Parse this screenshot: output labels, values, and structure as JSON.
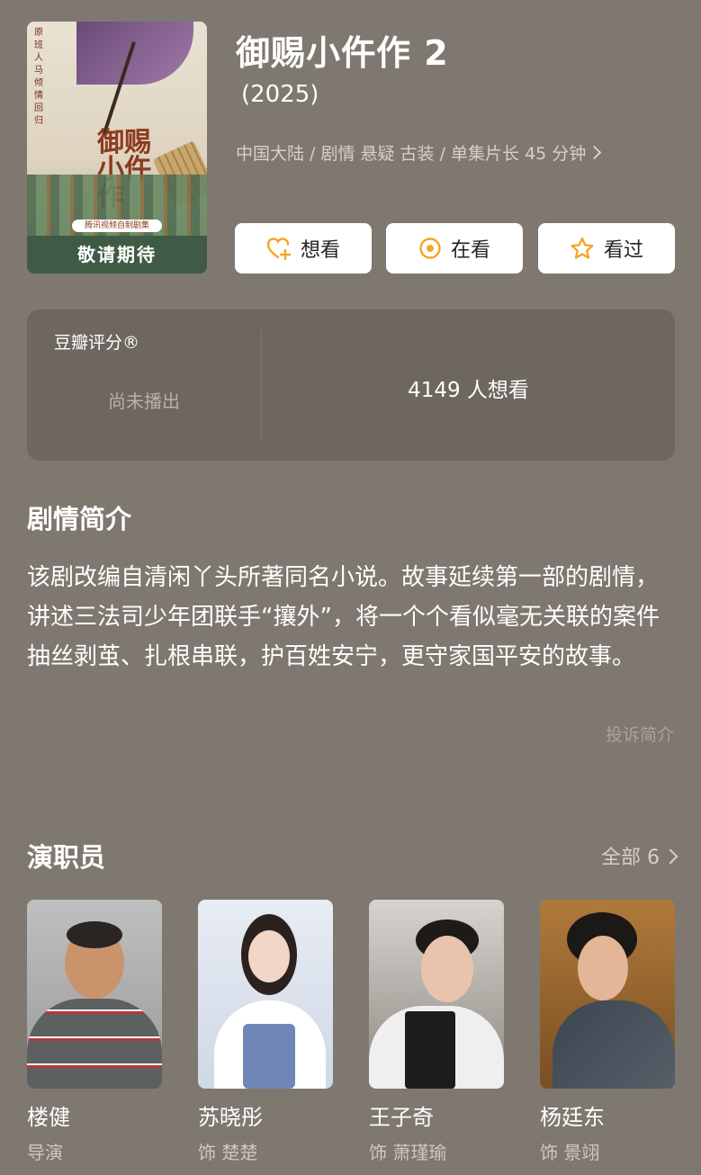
{
  "poster": {
    "side_text": "原班人马倾情回归",
    "calligraphy": "御赐小仵作",
    "ribbon": "腾讯视频自制剧集",
    "coming": "敬请期待"
  },
  "show": {
    "title": "御赐小仵作 2",
    "year": "(2025)",
    "meta": "中国大陆 / 剧情 悬疑 古装 / 单集片长 45 分钟"
  },
  "actions": {
    "want": "想看",
    "watching": "在看",
    "watched": "看过"
  },
  "rating": {
    "label": "豆瓣评分®",
    "status": "尚未播出",
    "wish_count": "4149 人想看"
  },
  "synopsis": {
    "heading": "剧情简介",
    "text": "该剧改编自清闲丫头所著同名小说。故事延续第一部的剧情，讲述三法司少年团联手“攘外”，将一个个看似毫无关联的案件抽丝剥茧、扎根串联，护百姓安宁，更守家国平安的故事。",
    "report": "投诉简介"
  },
  "cast": {
    "heading": "演职员",
    "all_link": "全部 6",
    "members": [
      {
        "name": "楼健",
        "role": "导演"
      },
      {
        "name": "苏晓彤",
        "role": "饰 楚楚"
      },
      {
        "name": "王子奇",
        "role": "饰 萧瑾瑜"
      },
      {
        "name": "杨廷东",
        "role": "饰 景翊"
      }
    ]
  },
  "colors": {
    "background": "#7f7870",
    "accent": "#f5a623"
  }
}
